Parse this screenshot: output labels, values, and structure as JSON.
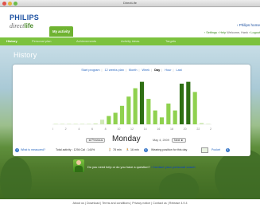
{
  "window": {
    "title": "DirectLife"
  },
  "header": {
    "brand": "PHILIPS",
    "logo_prefix": "direct",
    "logo_suffix": "life",
    "active_top_tab": "My activity",
    "home_link": "› Philips home",
    "links": {
      "settings": "› Settings",
      "help": "› Help",
      "welcome": "Welcome, Hank",
      "logout": "› Logout"
    }
  },
  "nav": {
    "items": [
      {
        "label": "History",
        "active": true
      },
      {
        "label": "Personal plan",
        "active": false
      },
      {
        "label": "Achievements",
        "active": false
      },
      {
        "label": "Activity ideas",
        "active": false
      },
      {
        "label": "Targets",
        "active": false
      }
    ]
  },
  "page": {
    "title": "History"
  },
  "range": {
    "options": [
      "Start program",
      "12 weeks plan",
      "Month",
      "Week",
      "Day",
      "Hour",
      "Last"
    ],
    "selected": "Day"
  },
  "chart_data": {
    "type": "bar",
    "categories": [
      "0",
      "1",
      "2",
      "3",
      "4",
      "5",
      "6",
      "7",
      "8",
      "9",
      "10",
      "11",
      "12",
      "13",
      "14",
      "15",
      "16",
      "17",
      "18",
      "19",
      "20",
      "21",
      "22",
      "23"
    ],
    "tick_labels": [
      "0",
      "2",
      "4",
      "6",
      "8",
      "10",
      "12",
      "14",
      "16",
      "18",
      "20",
      "22",
      "24"
    ],
    "values": [
      1,
      1,
      1,
      1,
      1,
      1,
      2,
      10,
      18,
      25,
      40,
      60,
      78,
      92,
      55,
      30,
      15,
      45,
      30,
      88,
      92,
      70,
      3,
      1
    ],
    "ylim": [
      0,
      100
    ],
    "highlight_color": "#2f6f14",
    "bar_color": "#8fd14f",
    "faint_color": "#cfe9b6",
    "grid": false
  },
  "day": {
    "previous_label": "◄ Previous",
    "next_label": "Next ►",
    "name": "Monday",
    "date": "May 4, 2009"
  },
  "stats": {
    "what_is_measured": "What is measured?",
    "total_activity": "Total activity : 1294 Cal : 144%",
    "walk": "78 min",
    "run": "16 min",
    "wearing": "Wearing position for this day",
    "pocket": "Pocket"
  },
  "help": {
    "text": "Do you need help or do you have a question?",
    "link": "› Contact your personal coach"
  },
  "footer": {
    "text": "About us | Download | Terms and conditions | Privacy notice | Contact us | Release 4.9.4"
  }
}
